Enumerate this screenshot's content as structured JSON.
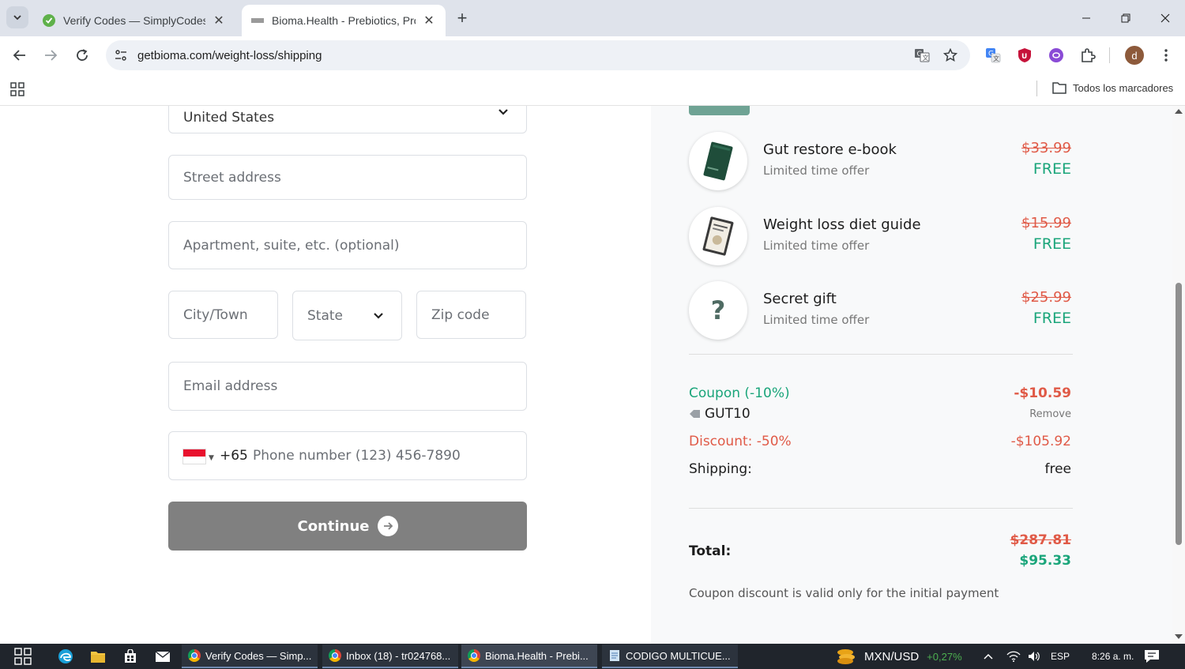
{
  "browser": {
    "tabs": [
      {
        "title": "Verify Codes — SimplyCodes",
        "active": false
      },
      {
        "title": "Bioma.Health - Prebiotics, Probiotics",
        "active": true
      }
    ],
    "url": "getbioma.com/weight-loss/shipping",
    "bookmarks_all": "Todos los marcadores",
    "profile_initial": "d"
  },
  "form": {
    "country_value": "United States",
    "street_placeholder": "Street address",
    "apartment_placeholder": "Apartment, suite, etc. (optional)",
    "city_placeholder": "City/Town",
    "state_placeholder": "State",
    "zip_placeholder": "Zip code",
    "email_placeholder": "Email address",
    "phone_dial_code": "+65",
    "phone_placeholder": "Phone number (123) 456-7890",
    "continue_label": "Continue"
  },
  "summary": {
    "items": [
      {
        "name": "Gut restore e-book",
        "subtitle": "Limited time offer",
        "old_price": "$33.99",
        "price": "FREE",
        "icon": "ebook-thumbnail"
      },
      {
        "name": "Weight loss diet guide",
        "subtitle": "Limited time offer",
        "old_price": "$15.99",
        "price": "FREE",
        "icon": "guide-thumbnail"
      },
      {
        "name": "Secret gift",
        "subtitle": "Limited time offer",
        "old_price": "$25.99",
        "price": "FREE",
        "icon": "question-mark-icon"
      }
    ],
    "coupon_label": "Coupon (-10%)",
    "coupon_amount": "-$10.59",
    "coupon_code": "GUT10",
    "coupon_remove": "Remove",
    "discount_label": "Discount: -50%",
    "discount_amount": "-$105.92",
    "shipping_label": "Shipping:",
    "shipping_value": "free",
    "total_label": "Total:",
    "total_old": "$287.81",
    "total_new": "$95.33",
    "note": "Coupon discount is valid only for the initial payment",
    "colors": {
      "green": "#1aa57a",
      "red": "#e05a47"
    }
  },
  "taskbar": {
    "apps": [
      {
        "label": "Verify Codes — Simp..."
      },
      {
        "label": "Inbox (18) - tr024768..."
      },
      {
        "label": "Bioma.Health - Prebi..."
      },
      {
        "label": "CODIGO MULTICUE..."
      }
    ],
    "ticker_label": "MXN/USD",
    "ticker_change": "+0,27%",
    "language": "ESP",
    "clock": "8:26 a. m."
  }
}
